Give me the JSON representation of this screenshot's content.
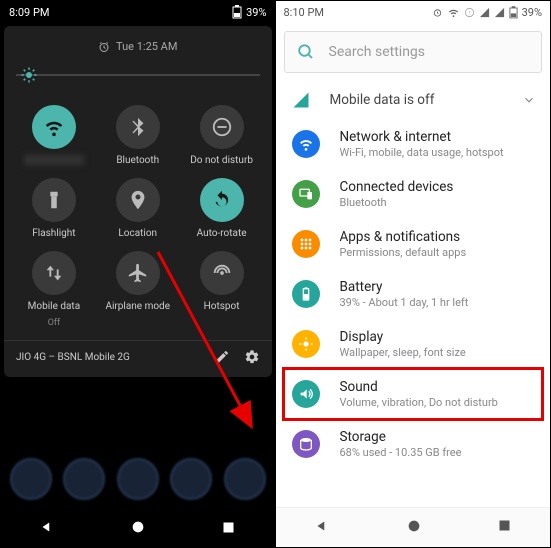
{
  "left": {
    "status": {
      "time": "8:09 PM",
      "battery": "39%"
    },
    "alarm_text": "Tue 1:25 AM",
    "tiles": [
      {
        "label": "",
        "icon": "wifi",
        "active": true,
        "blurred": true
      },
      {
        "label": "Bluetooth",
        "icon": "bluetooth",
        "active": false
      },
      {
        "label": "Do not disturb",
        "icon": "dnd",
        "active": false
      },
      {
        "label": "Flashlight",
        "icon": "flashlight",
        "active": false
      },
      {
        "label": "Location",
        "icon": "location",
        "active": false
      },
      {
        "label": "Auto-rotate",
        "icon": "rotate",
        "active": true
      },
      {
        "label": "Mobile data",
        "sublabel": "Off",
        "icon": "mobiledata",
        "active": false
      },
      {
        "label": "Airplane mode",
        "icon": "airplane",
        "active": false
      },
      {
        "label": "Hotspot",
        "icon": "hotspot",
        "active": false
      }
    ],
    "footer_text": "JIO 4G – BSNL Mobile 2G"
  },
  "right": {
    "status": {
      "time": "8:10 PM",
      "battery": "39%"
    },
    "search_placeholder": "Search settings",
    "suggestion_text": "Mobile data is off",
    "items": [
      {
        "title": "Network & internet",
        "sub": "Wi‑Fi, mobile, data usage, hotspot",
        "color": "#1a73e8",
        "icon": "wifi"
      },
      {
        "title": "Connected devices",
        "sub": "Bluetooth",
        "color": "#43a047",
        "icon": "devices"
      },
      {
        "title": "Apps & notifications",
        "sub": "Permissions, default apps",
        "color": "#fb8c00",
        "icon": "apps"
      },
      {
        "title": "Battery",
        "sub": "39% - About 1 day, 1 hr left",
        "color": "#26a69a",
        "icon": "battery"
      },
      {
        "title": "Display",
        "sub": "Wallpaper, sleep, font size",
        "color": "#ffb300",
        "icon": "display"
      },
      {
        "title": "Sound",
        "sub": "Volume, vibration, Do not disturb",
        "color": "#26a69a",
        "icon": "sound",
        "highlight": true
      },
      {
        "title": "Storage",
        "sub": "68% used - 10.35 GB free",
        "color": "#7e57c2",
        "icon": "storage"
      }
    ]
  }
}
